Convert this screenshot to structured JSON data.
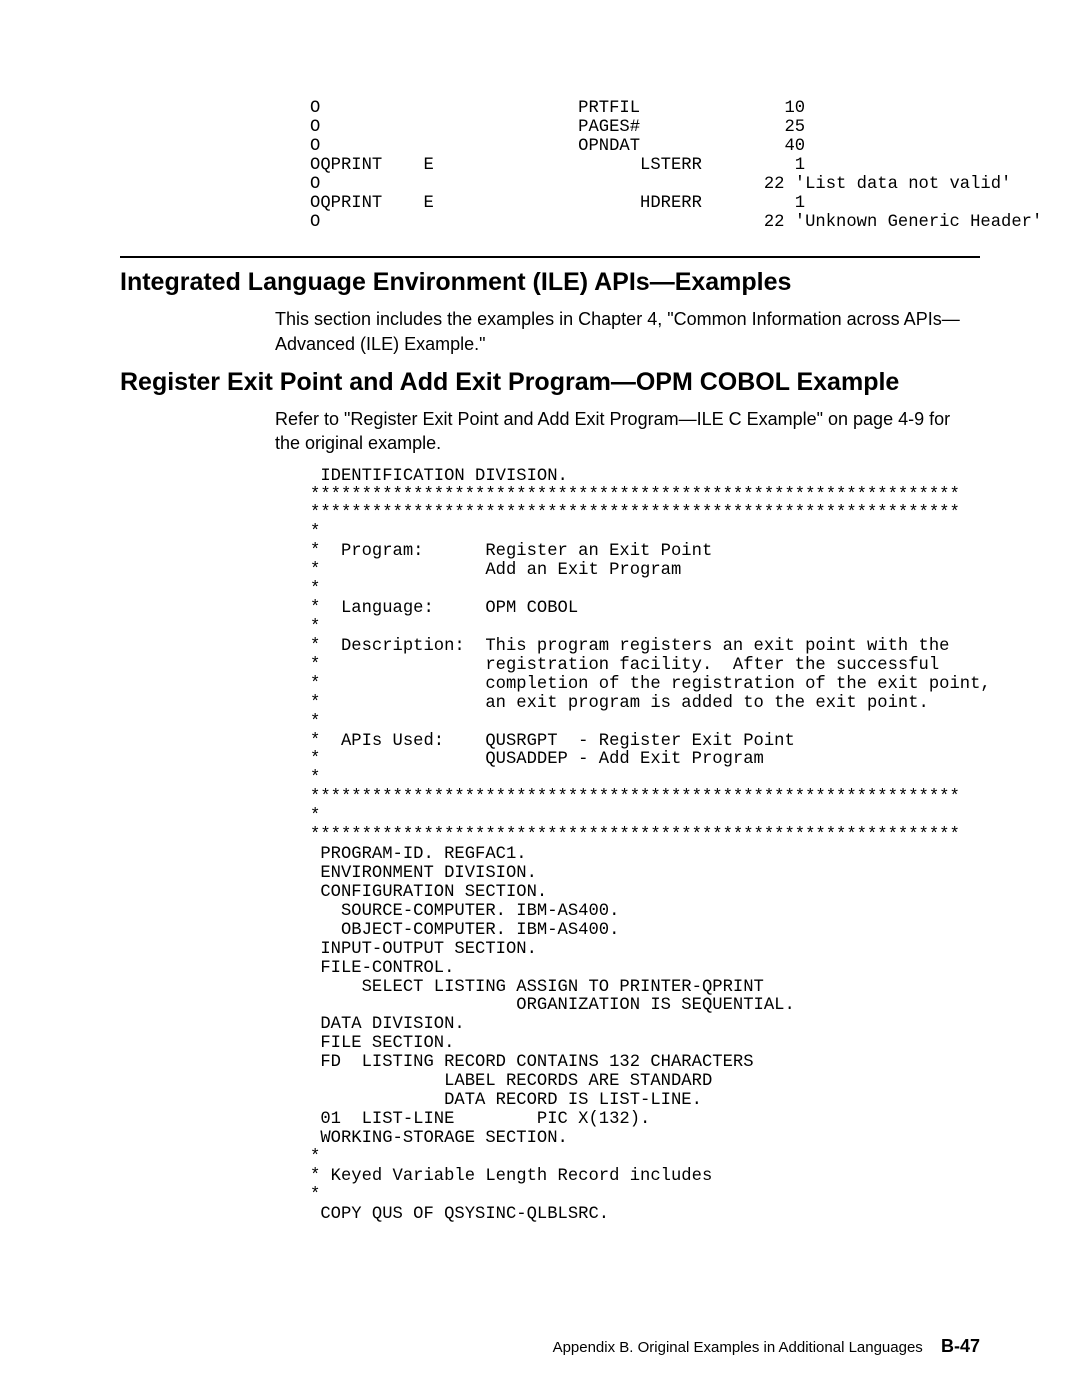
{
  "codeTop": "O                         PRTFIL              10\nO                         PAGES#              25\nO                         OPNDAT              40\nOQPRINT    E                    LSTERR         1\nO                                           22 'List data not valid'\nOQPRINT    E                    HDRERR         1\nO                                           22 'Unknown Generic Header'",
  "heading1": "Integrated Language Environment (ILE) APIs—Examples",
  "para1": "This section includes the examples in Chapter 4, \"Common Information across APIs—Advanced (ILE) Example.\"",
  "heading2": "Register Exit Point and Add Exit Program—OPM COBOL Example",
  "para2": "Refer to \"Register Exit Point and Add Exit Program—ILE C Example\" on page 4-9 for the original example.",
  "codeMain": " IDENTIFICATION DIVISION.\n***************************************************************\n***************************************************************\n*\n*  Program:      Register an Exit Point\n*                Add an Exit Program\n*\n*  Language:     OPM COBOL\n*\n*  Description:  This program registers an exit point with the\n*                registration facility.  After the successful\n*                completion of the registration of the exit point,\n*                an exit program is added to the exit point.\n*\n*  APIs Used:    QUSRGPT  - Register Exit Point\n*                QUSADDEP - Add Exit Program\n*\n***************************************************************\n*\n***************************************************************\n PROGRAM-ID. REGFAC1.\n ENVIRONMENT DIVISION.\n CONFIGURATION SECTION.\n   SOURCE-COMPUTER. IBM-AS400.\n   OBJECT-COMPUTER. IBM-AS400.\n INPUT-OUTPUT SECTION.\n FILE-CONTROL.\n     SELECT LISTING ASSIGN TO PRINTER-QPRINT\n                    ORGANIZATION IS SEQUENTIAL.\n DATA DIVISION.\n FILE SECTION.\n FD  LISTING RECORD CONTAINS 132 CHARACTERS\n             LABEL RECORDS ARE STANDARD\n             DATA RECORD IS LIST-LINE.\n 01  LIST-LINE        PIC X(132).\n WORKING-STORAGE SECTION.\n*\n* Keyed Variable Length Record includes\n*\n COPY QUS OF QSYSINC-QLBLSRC.",
  "footer": {
    "text": "Appendix B.  Original Examples in Additional Languages",
    "page": "B-47"
  }
}
